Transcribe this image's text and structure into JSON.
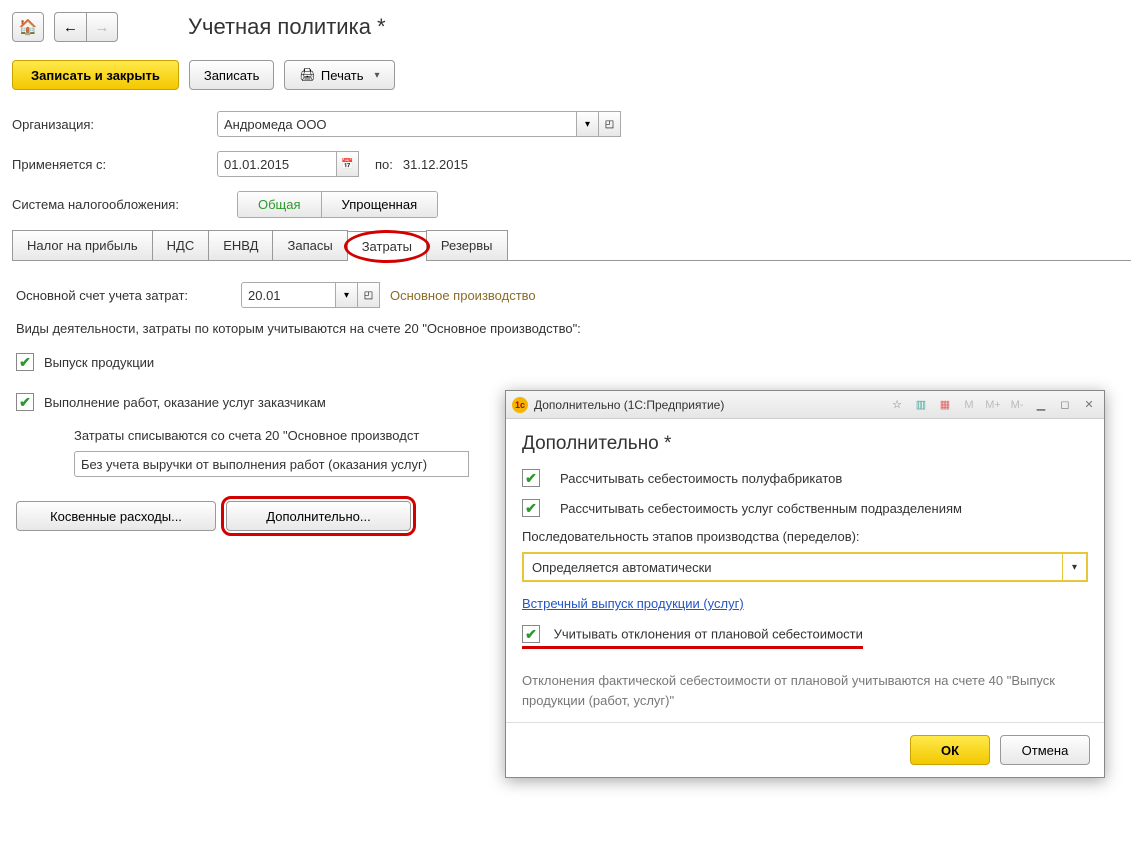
{
  "header": {
    "title": "Учетная политика *"
  },
  "toolbar": {
    "save_close": "Записать и закрыть",
    "save": "Записать",
    "print": "Печать"
  },
  "form": {
    "org_label": "Организация:",
    "org_value": "Андромеда ООО",
    "applied_label": "Применяется с:",
    "applied_value": "01.01.2015",
    "applied_to_label": "по:",
    "applied_to_value": "31.12.2015",
    "taxsys_label": "Система налогообложения:",
    "taxsys_common": "Общая",
    "taxsys_simple": "Упрощенная"
  },
  "tabs": [
    "Налог на прибыль",
    "НДС",
    "ЕНВД",
    "Запасы",
    "Затраты",
    "Резервы"
  ],
  "costs": {
    "acct_label": "Основной счет учета затрат:",
    "acct_value": "20.01",
    "acct_desc": "Основное производство",
    "kinds_label": "Виды деятельности, затраты по которым учитываются на счете 20 \"Основное производство\":",
    "chk_output": "Выпуск продукции",
    "chk_works": "Выполнение работ, оказание услуг заказчикам",
    "writeoff_label": "Затраты списываются со счета 20 \"Основное производст",
    "writeoff_value": "Без учета выручки от выполнения работ (оказания услуг)",
    "btn_indirect": "Косвенные расходы...",
    "btn_additional": "Дополнительно..."
  },
  "modal": {
    "titlebar": "Дополнительно  (1С:Предприятие)",
    "title": "Дополнительно *",
    "chk_semi": "Рассчитывать себестоимость полуфабрикатов",
    "chk_serv": "Рассчитывать себестоимость услуг собственным подразделениям",
    "seq_label": "Последовательность этапов производства (переделов):",
    "seq_value": "Определяется автоматически",
    "link": "Встречный выпуск продукции (услуг)",
    "chk_dev": "Учитывать отклонения от плановой себестоимости",
    "hint": "Отклонения фактической себестоимости от плановой учитываются на счете 40 \"Выпуск продукции (работ, услуг)\"",
    "ok": "ОК",
    "cancel": "Отмена",
    "tb_m": "M",
    "tb_mplus": "M+",
    "tb_mminus": "M-"
  }
}
